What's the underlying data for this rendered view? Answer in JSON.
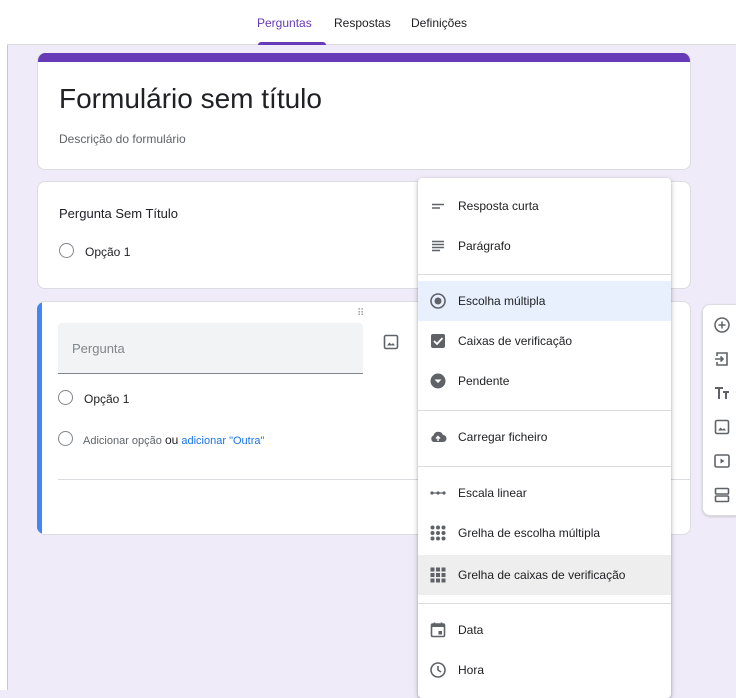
{
  "tabs": [
    {
      "label": "Perguntas",
      "active": true
    },
    {
      "label": "Respostas",
      "active": false
    },
    {
      "label": "Definições",
      "active": false
    }
  ],
  "form": {
    "title": "Formulário sem título",
    "description": "Descrição do formulário"
  },
  "question1": {
    "title": "Pergunta Sem Título",
    "option": "Opção 1"
  },
  "question2": {
    "placeholder": "Pergunta",
    "option": "Opção 1",
    "add_option": "Adicionar opção",
    "or": "ou",
    "add_other": "adicionar \"Outra\""
  },
  "menu": [
    {
      "label": "Resposta curta",
      "icon": "short-answer-icon"
    },
    {
      "label": "Parágrafo",
      "icon": "paragraph-icon"
    },
    {
      "label": "Escolha múltipla",
      "icon": "radio-button-icon",
      "selected": true
    },
    {
      "label": "Caixas de verificação",
      "icon": "checkbox-icon"
    },
    {
      "label": "Pendente",
      "icon": "dropdown-icon"
    },
    {
      "label": "Carregar ficheiro",
      "icon": "cloud-upload-icon"
    },
    {
      "label": "Escala linear",
      "icon": "linear-scale-icon"
    },
    {
      "label": "Grelha de escolha múltipla",
      "icon": "multiple-choice-grid-icon"
    },
    {
      "label": "Grelha de caixas de verificação",
      "icon": "checkbox-grid-icon",
      "hovered": true
    },
    {
      "label": "Data",
      "icon": "calendar-icon"
    },
    {
      "label": "Hora",
      "icon": "clock-icon"
    }
  ],
  "side_toolbar": [
    "add-question-icon",
    "import-questions-icon",
    "add-title-icon",
    "add-image-icon",
    "add-video-icon",
    "add-section-icon"
  ],
  "colors": {
    "accent": "#673ab7",
    "active_question": "#4285f4",
    "link": "#1a73e8",
    "background": "#efebf8"
  }
}
